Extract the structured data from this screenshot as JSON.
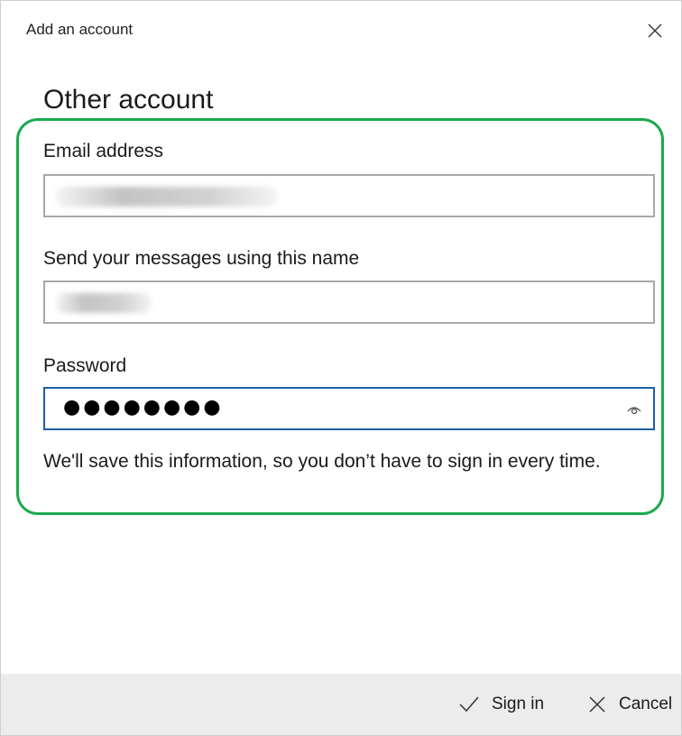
{
  "window": {
    "title": "Add an account",
    "close_icon": "close-icon"
  },
  "form": {
    "heading": "Other account",
    "email": {
      "label": "Email address",
      "value": ""
    },
    "display_name": {
      "label": "Send your messages using this name",
      "value": ""
    },
    "password": {
      "label": "Password",
      "masked_value": "●●●●●●●●",
      "reveal_icon": "eye-icon"
    },
    "info": "We'll save this information, so you don’t have to sign in every time."
  },
  "footer": {
    "sign_in_label": "Sign in",
    "cancel_label": "Cancel",
    "sign_in_icon": "checkmark-icon",
    "cancel_icon": "close-icon"
  },
  "colors": {
    "highlight": "#1aaa4e",
    "focus_border": "#1b5fa6",
    "footer_bg": "#ececec"
  }
}
